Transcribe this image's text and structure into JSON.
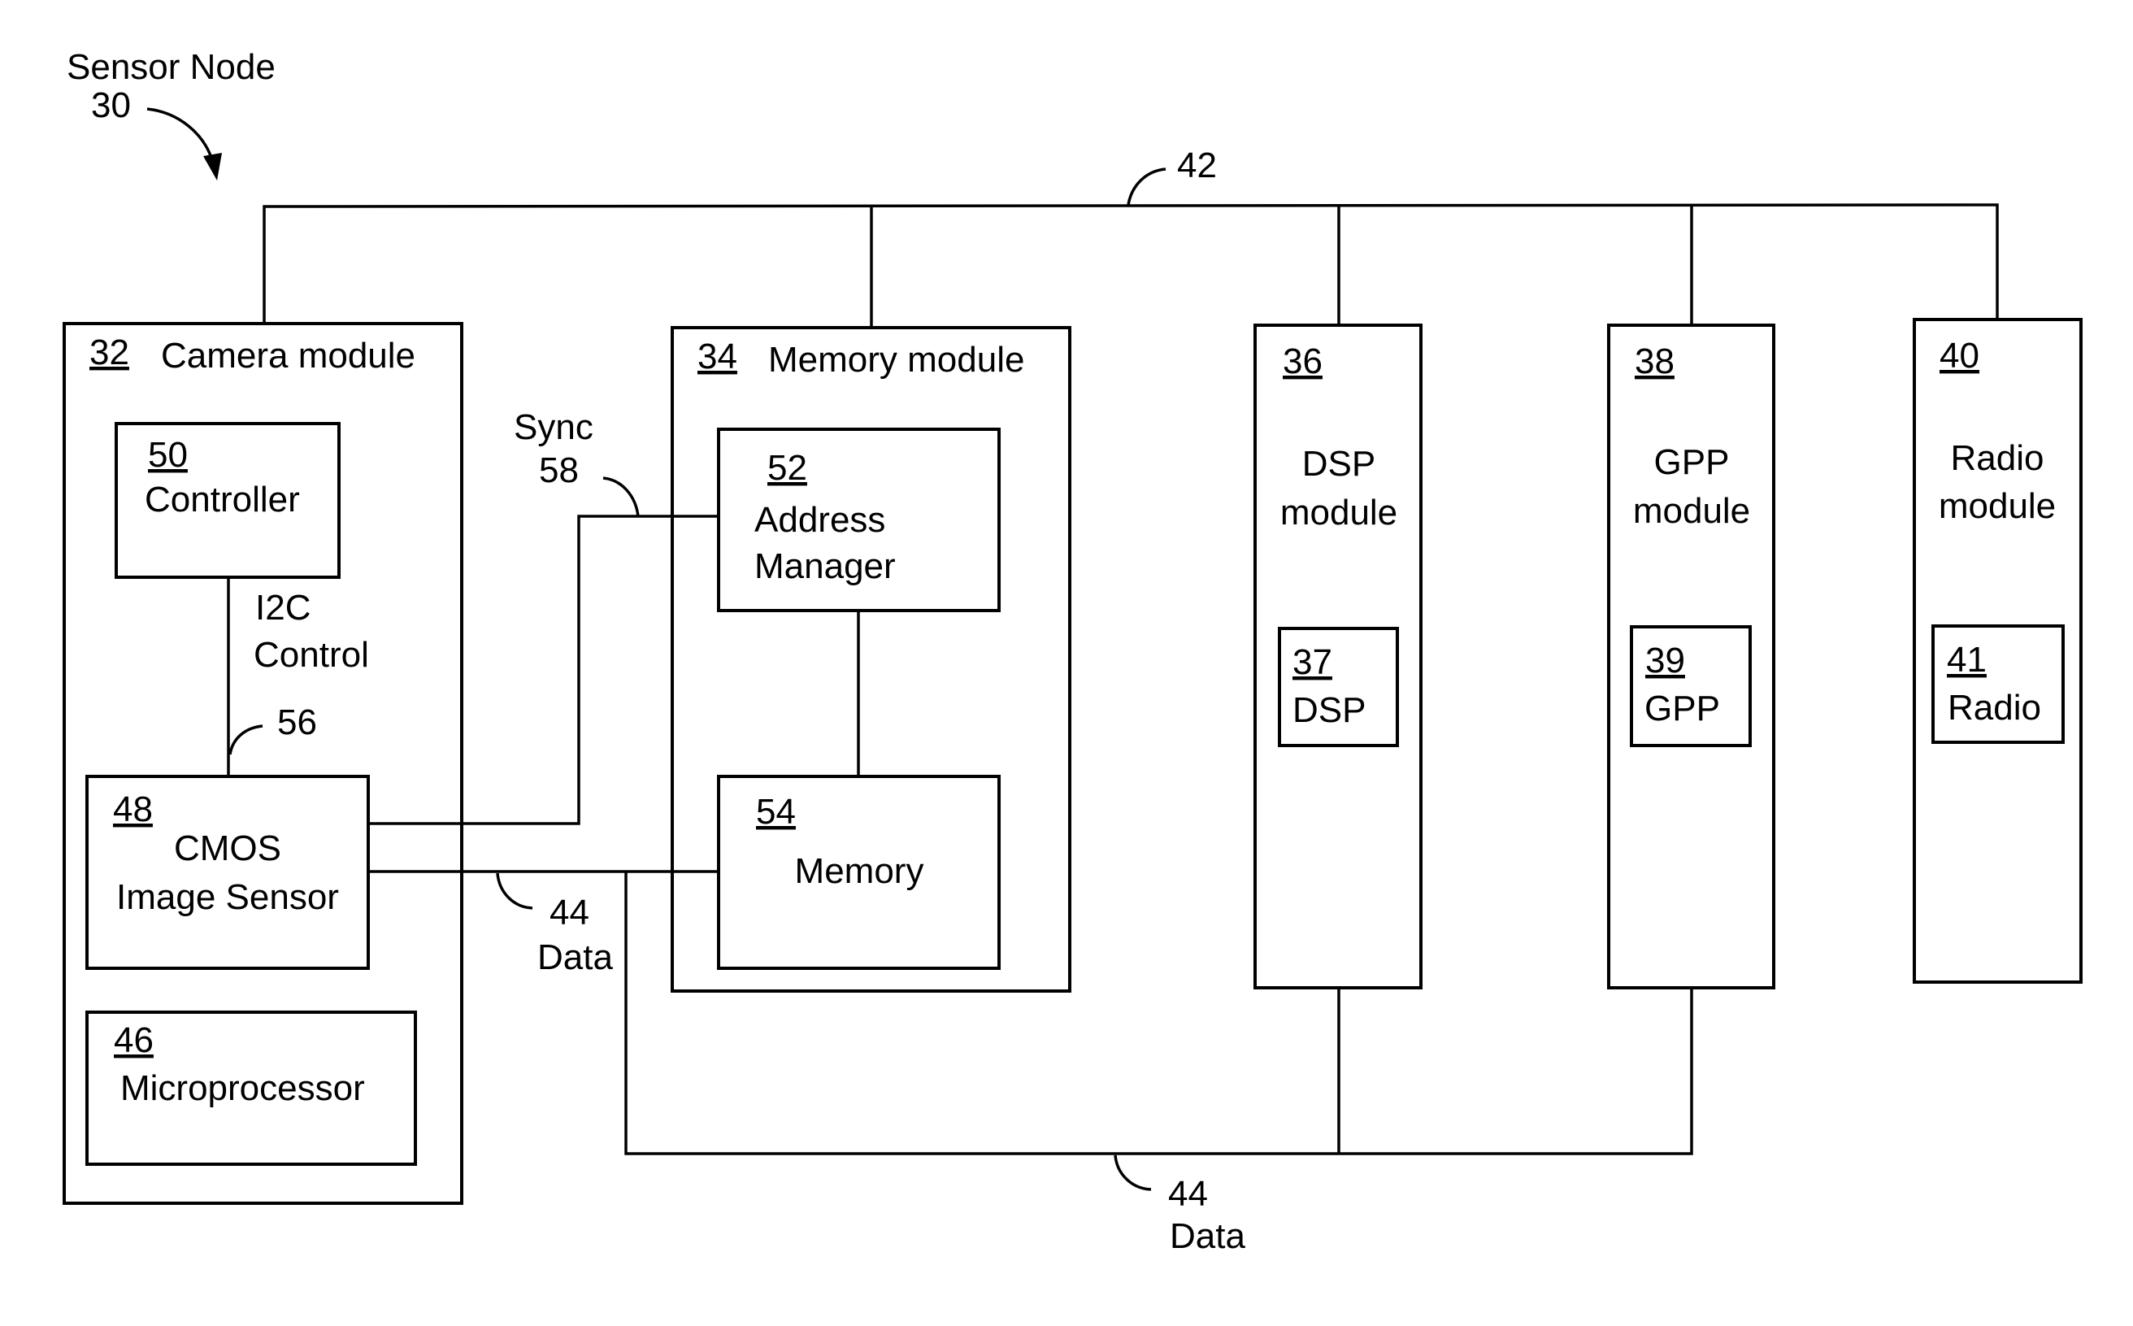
{
  "diagram": {
    "title": "Sensor Node",
    "title_ref": "30",
    "bus_top": {
      "ref": "42"
    },
    "data_bus_mid": {
      "ref": "44",
      "label": "Data"
    },
    "data_bus_bottom": {
      "ref": "44",
      "label": "Data"
    },
    "i2c": {
      "line1": "I2C",
      "line2": "Control",
      "ref": "56"
    },
    "sync": {
      "label": "Sync",
      "ref": "58"
    },
    "camera_module": {
      "ref": "32",
      "label": "Camera module",
      "controller": {
        "ref": "50",
        "label": "Controller"
      },
      "cmos": {
        "ref": "48",
        "line1": "CMOS",
        "line2": "Image Sensor"
      },
      "microprocessor": {
        "ref": "46",
        "label": "Microprocessor"
      }
    },
    "memory_module": {
      "ref": "34",
      "label": "Memory module",
      "address_manager": {
        "ref": "52",
        "line1": "Address",
        "line2": "Manager"
      },
      "memory": {
        "ref": "54",
        "label": "Memory"
      }
    },
    "dsp_module": {
      "ref": "36",
      "line1": "DSP",
      "line2": "module",
      "inner": {
        "ref": "37",
        "label": "DSP"
      }
    },
    "gpp_module": {
      "ref": "38",
      "line1": "GPP",
      "line2": "module",
      "inner": {
        "ref": "39",
        "label": "GPP"
      }
    },
    "radio_module": {
      "ref": "40",
      "line1": "Radio",
      "line2": "module",
      "inner": {
        "ref": "41",
        "label": "Radio"
      }
    }
  }
}
